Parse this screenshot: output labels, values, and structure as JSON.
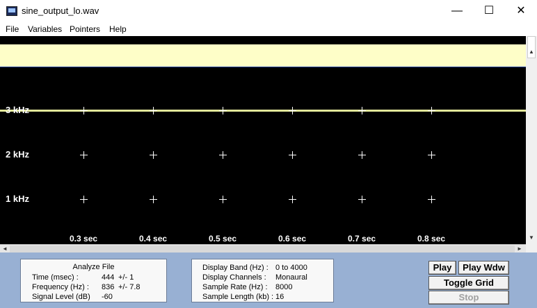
{
  "window": {
    "title": "sine_output_lo.wav",
    "controls": {
      "minimize": "—",
      "maximize": "☐",
      "close": "✕"
    }
  },
  "menu": [
    "File",
    "Variables",
    "Pointers",
    "Help"
  ],
  "plot": {
    "y_labels": [
      "3  kHz",
      "2  kHz",
      "1  kHz"
    ],
    "x_labels": [
      "0.3 sec",
      "0.4 sec",
      "0.5 sec",
      "0.6 sec",
      "0.7 sec",
      "0.8 sec"
    ],
    "colors": {
      "background": "#000000",
      "strip": "#fefec8",
      "signal": "#e3e89a",
      "grid": "#ffffff"
    }
  },
  "scroll_glyphs": {
    "up": "▲",
    "down": "▼",
    "left": "◄",
    "right": "►"
  },
  "analyze": {
    "title": "Analyze File",
    "rows": [
      {
        "label": "Time (msec) :",
        "value": "444",
        "tol": "+/- 1"
      },
      {
        "label": "Frequency (Hz) :",
        "value": "836",
        "tol": "+/- 7.8"
      },
      {
        "label": "Signal Level (dB)",
        "value": "-60",
        "tol": ""
      }
    ]
  },
  "display": {
    "rows": [
      {
        "label": "Display Band (Hz) :",
        "value": "0 to 4000"
      },
      {
        "label": "Display Channels :",
        "value": "Monaural"
      },
      {
        "label": "Sample Rate (Hz) :",
        "value": "8000"
      },
      {
        "label": "Sample Length (kb) :",
        "value": "16"
      }
    ]
  },
  "buttons": {
    "play": "Play",
    "play_wdw": "Play Wdw",
    "toggle_grid": "Toggle Grid",
    "stop": "Stop"
  }
}
